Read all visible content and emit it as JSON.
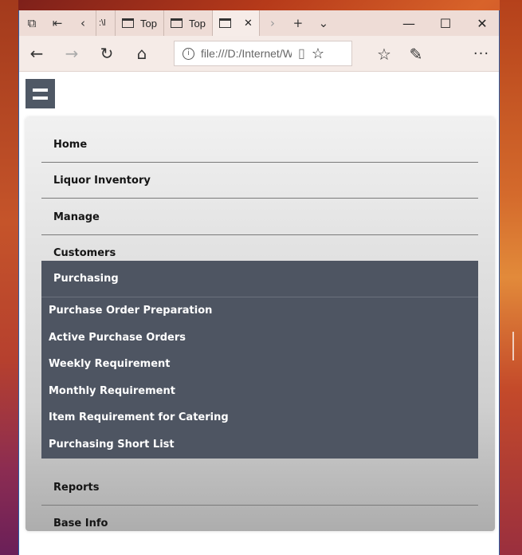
{
  "tabbar": {
    "tabs": [
      {
        "label": ":\\l"
      },
      {
        "label": "Top"
      },
      {
        "label": "Top"
      },
      {
        "label": ""
      }
    ]
  },
  "navbar": {
    "address": "file:///D:/Internet/W"
  },
  "menu": {
    "items_top": [
      {
        "label": "Home"
      },
      {
        "label": "Liquor Inventory"
      },
      {
        "label": "Manage"
      },
      {
        "label": "Customers"
      }
    ],
    "active": {
      "label": "Purchasing",
      "children": [
        {
          "label": "Purchase Order Preparation"
        },
        {
          "label": "Active Purchase Orders"
        },
        {
          "label": "Weekly Requirement"
        },
        {
          "label": "Monthly Requirement"
        },
        {
          "label": "Item Requirement for Catering"
        },
        {
          "label": "Purchasing Short List"
        }
      ]
    },
    "items_bottom": [
      {
        "label": "Reports"
      },
      {
        "label": "Base Info"
      }
    ]
  },
  "colors": {
    "menu_active_bg": "#4e5562",
    "hamburger_bg": "#4f5865",
    "tabbar_bg": "#eedcd6"
  }
}
